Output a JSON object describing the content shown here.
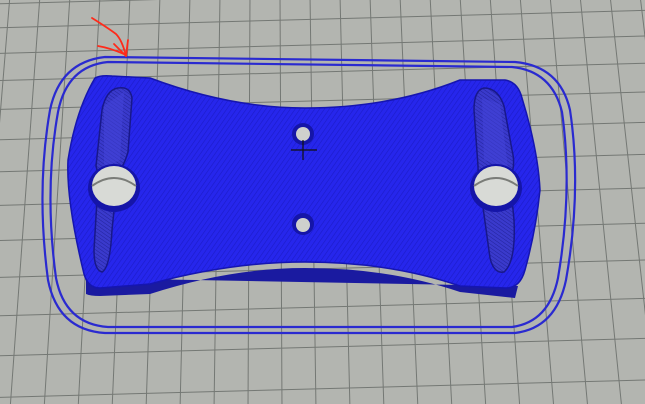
{
  "viewport": {
    "background_color": "#b3b5b0",
    "grid_color": "#6a6e6a"
  },
  "model": {
    "fill_color": "#2323e8",
    "edge_color": "#1515b0",
    "shadow_color": "#1a1aa0",
    "hole_color": "#d8dad6",
    "skirt_color": "#2a2ad0"
  },
  "annotation": {
    "arrow_color": "#ff2a1a"
  },
  "icons": {
    "origin_marker": "crosshair-icon"
  }
}
